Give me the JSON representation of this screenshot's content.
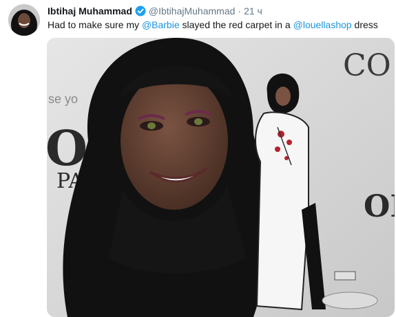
{
  "tweet": {
    "author_name": "Ibtihaj Muhammad",
    "handle": "@IbtihajMuhammad",
    "separator": "·",
    "timestamp": "21 ч",
    "text_part1": "Had to make sure my ",
    "mention_barbie": "@Barbie",
    "text_part2": " slayed the red carpet in a ",
    "mention_shop": "@louellashop",
    "text_part3": " dress"
  },
  "photo": {
    "backdrop_word_1": "CO",
    "backdrop_word_2": "ORE",
    "backdrop_word_3": "PA",
    "backdrop_word_4": "se yo",
    "backdrop_word_5": "OR"
  },
  "icons": {
    "verified": "verified-badge-icon",
    "avatar": "avatar-photo"
  },
  "colors": {
    "link": "#1b95e0",
    "name": "#14171a",
    "meta": "#657786",
    "verified": "#1da1f2"
  }
}
